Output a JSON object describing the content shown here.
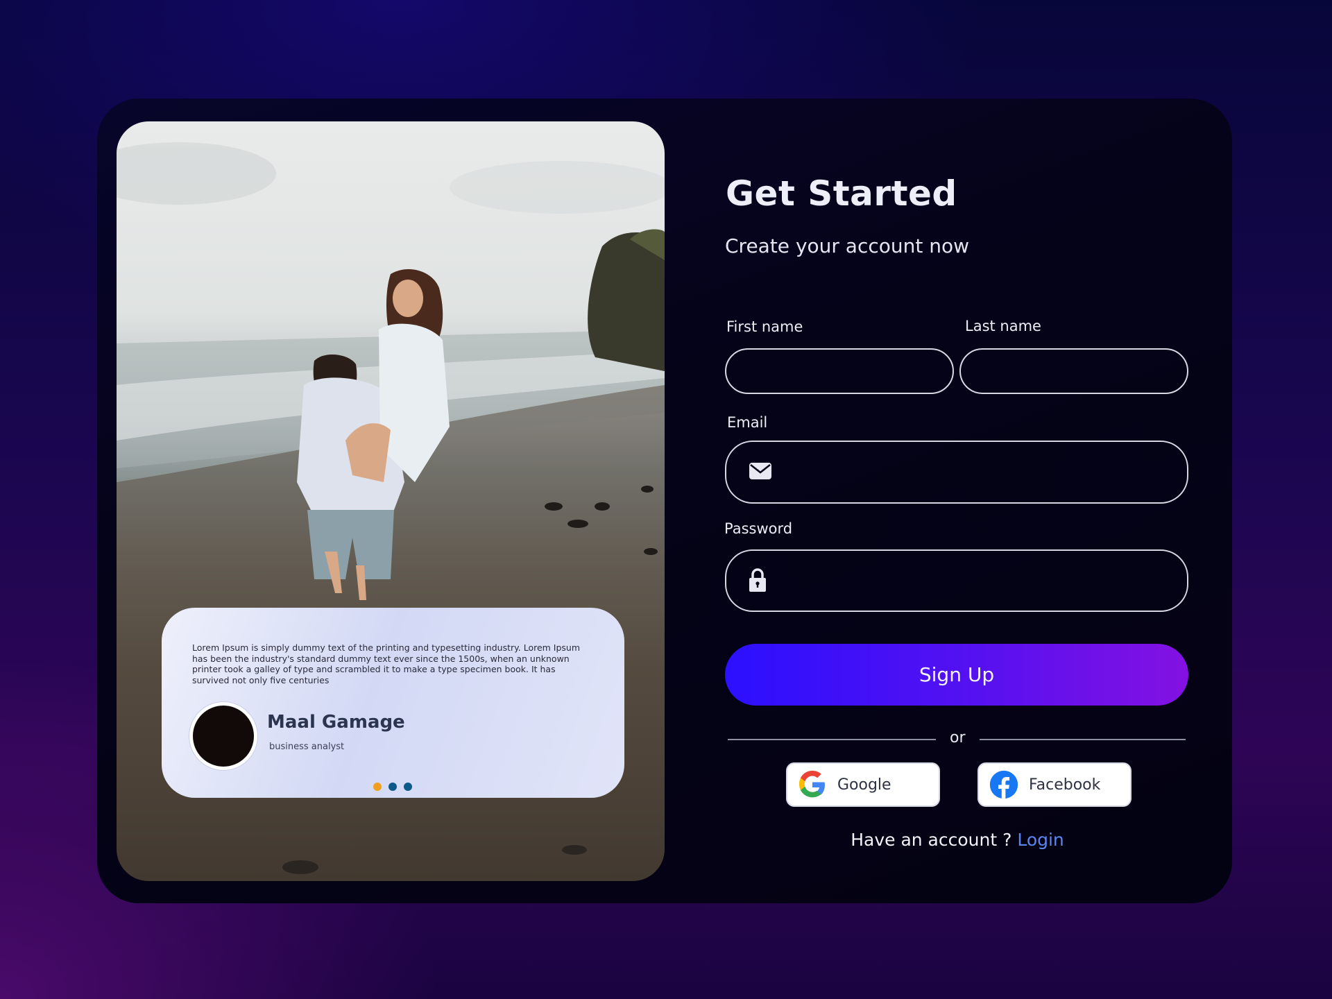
{
  "form": {
    "title": "Get Started",
    "subtitle": "Create your account now",
    "first_name_label": "First name",
    "last_name_label": "Last name",
    "first_name_value": "",
    "last_name_value": "",
    "email_label": "Email",
    "email_value": "",
    "password_label": "Password",
    "password_value": "",
    "email_icon": "envelope-icon",
    "password_icon": "lock-icon",
    "signup_label": "Sign Up",
    "divider_text": "or",
    "google_label": "Google",
    "facebook_label": "Facebook",
    "have_account_text": "Have an account ?",
    "login_link": "Login"
  },
  "testimonial": {
    "quote": "Lorem Ipsum is simply dummy text of the printing and typesetting industry. Lorem Ipsum has been the industry's standard dummy text ever since the 1500s, when an unknown printer took a galley of type and scrambled it to make a type specimen book. It has survived not only five centuries",
    "name": "Maal Gamage",
    "role": "business analyst",
    "dots": [
      "#f0a020",
      "#0d5a8a",
      "#0d5a8a"
    ]
  },
  "colors": {
    "accent_start": "#2b10ff",
    "accent_end": "#8411e2",
    "link": "#5b86f0"
  }
}
